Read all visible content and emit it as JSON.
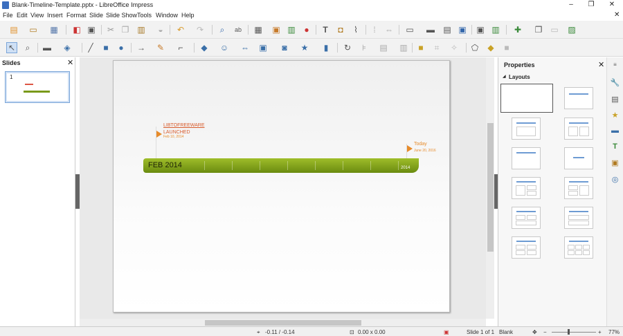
{
  "window": {
    "title": "Blank-Timeline-Template.pptx - LibreOffice Impress",
    "minimize": "–",
    "maximize": "❐",
    "close": "✕",
    "doc_close": "✕"
  },
  "menu": [
    "File",
    "Edit",
    "View",
    "Insert",
    "Format",
    "Slide",
    "Slide Show",
    "Tools",
    "Window",
    "Help"
  ],
  "slides_panel": {
    "title": "Slides",
    "close": "✕",
    "slide_number": "1"
  },
  "slide": {
    "bar_label": "FEB 2014",
    "bar_year": "2014",
    "event1": {
      "title1": "LIBTOFREEWARE",
      "title2": "LAUNCHED",
      "date": "Feb 10, 2014"
    },
    "event2": {
      "title": "Today",
      "date": "June 20, 2016"
    }
  },
  "properties": {
    "title": "Properties",
    "close": "✕",
    "section": "Layouts",
    "section_icon": "◢"
  },
  "status": {
    "position": "-0.11 / -0.14",
    "size": "0.00 x 0.00",
    "slide": "Slide 1 of 1",
    "master": "Blank",
    "zoom": "77%",
    "zoom_minus": "−",
    "zoom_plus": "+"
  }
}
